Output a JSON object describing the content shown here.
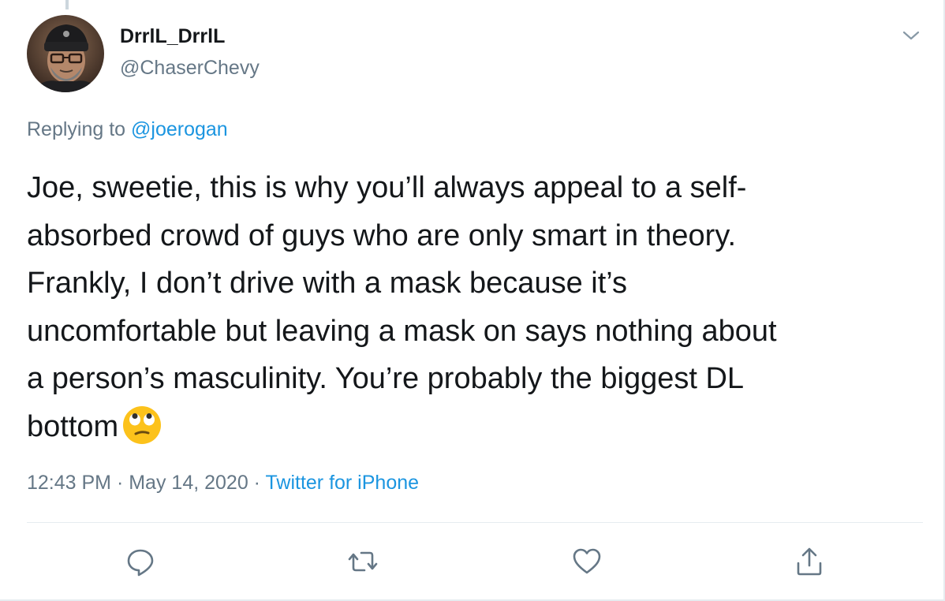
{
  "tweet": {
    "display_name": "DrrlL_DrrlL",
    "handle": "@ChaserChevy",
    "replying_prefix": "Replying to ",
    "replying_mention": "@joerogan",
    "text": "Joe, sweetie, this is why you’ll always appeal to a self-\nabsorbed crowd of guys who are only smart in theory.\nFrankly, I don’t drive with a mask because it’s\nuncomfortable but leaving a mask on says nothing about\na person’s masculinity. You’re probably the biggest DL\nbottom",
    "emoji": "face-with-rolling-eyes",
    "time": "12:43 PM",
    "separator": " · ",
    "date": "May 14, 2020",
    "source": "Twitter for iPhone"
  },
  "icons": {
    "menu": "chevron-down-icon",
    "reply": "reply-icon",
    "retweet": "retweet-icon",
    "like": "heart-icon",
    "share": "share-icon"
  },
  "colors": {
    "link": "#1b95e0",
    "secondary_text": "#657786",
    "primary_text": "#14171a",
    "divider": "#e6ecf0"
  }
}
